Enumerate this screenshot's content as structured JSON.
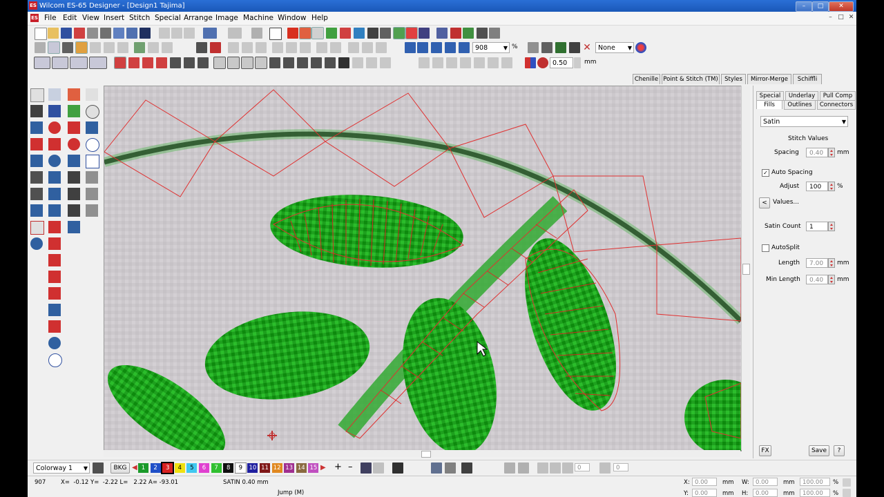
{
  "window": {
    "title": "Wilcom ES-65 Designer - [Design1          Tajima]",
    "app_icon": "ES",
    "controls": {
      "minimize": "–",
      "maximize": "□",
      "close": "✕"
    }
  },
  "menu": {
    "items": [
      "File",
      "Edit",
      "View",
      "Insert",
      "Stitch",
      "Special",
      "Arrange",
      "Image",
      "Machine",
      "Window",
      "Help"
    ]
  },
  "toolbar": {
    "zoom_value": "908",
    "zoom_unit": "%",
    "none_select": "None",
    "width_value": "0.50",
    "width_unit": "mm"
  },
  "right_tabs": [
    "Chenille",
    "Point & Stitch (TM)",
    "Styles",
    "Mirror-Merge",
    "Schiffli"
  ],
  "panel": {
    "tabs_row1": [
      "Special",
      "Underlay",
      "Pull Comp"
    ],
    "tabs_row2": [
      "Fills",
      "Outlines",
      "Connectors"
    ],
    "fill_type": "Satin",
    "stitch_values_label": "Stitch Values",
    "spacing_label": "Spacing",
    "spacing_value": "0.40",
    "spacing_unit": "mm",
    "auto_spacing_label": "Auto Spacing",
    "auto_spacing_checked": "✓",
    "adjust_label": "Adjust",
    "adjust_value": "100",
    "adjust_unit": "%",
    "values_label": "Values...",
    "values_button": "<",
    "satin_count_label": "Satin Count",
    "satin_count_value": "1",
    "autosplit_label": "AutoSplit",
    "length_label": "Length",
    "length_value": "7.00",
    "length_unit": "mm",
    "min_length_label": "Min Length",
    "min_length_value": "0.40",
    "min_length_unit": "mm",
    "fx_button": "FX",
    "save_button": "Save",
    "help_button": "?"
  },
  "colorbar": {
    "colorway": "Colorway 1",
    "bkg": "BKG",
    "swatches": [
      {
        "n": "1",
        "color": "#1a9a2a"
      },
      {
        "n": "2",
        "color": "#2050c8"
      },
      {
        "n": "3",
        "color": "#d82020"
      },
      {
        "n": "4",
        "color": "#f0e010"
      },
      {
        "n": "5",
        "color": "#40c8f0"
      },
      {
        "n": "6",
        "color": "#e040d0"
      },
      {
        "n": "7",
        "color": "#30c030"
      },
      {
        "n": "8",
        "color": "#101010"
      },
      {
        "n": "9",
        "color": "#ffffff"
      },
      {
        "n": "10",
        "color": "#2020a0"
      },
      {
        "n": "11",
        "color": "#801818"
      },
      {
        "n": "12",
        "color": "#e08820"
      },
      {
        "n": "13",
        "color": "#a03090"
      },
      {
        "n": "14",
        "color": "#8a6a40"
      },
      {
        "n": "15",
        "color": "#c050c0"
      }
    ],
    "field1": "0",
    "field2": "0"
  },
  "status": {
    "stitch_count": "907",
    "coords": "X=  -0.12 Y=  -2.22 L=   2.22 A= -93.01",
    "stitch_type": "SATIN  0.40 mm",
    "jump": "Jump (M)",
    "x_label": "X:",
    "x_value": "0.00",
    "y_label": "Y:",
    "y_value": "0.00",
    "w_label": "W:",
    "w_value": "0.00",
    "h_label": "H:",
    "h_value": "0.00",
    "unit": "mm",
    "wp_value": "100.00",
    "hp_value": "100.00",
    "pct": "%"
  }
}
